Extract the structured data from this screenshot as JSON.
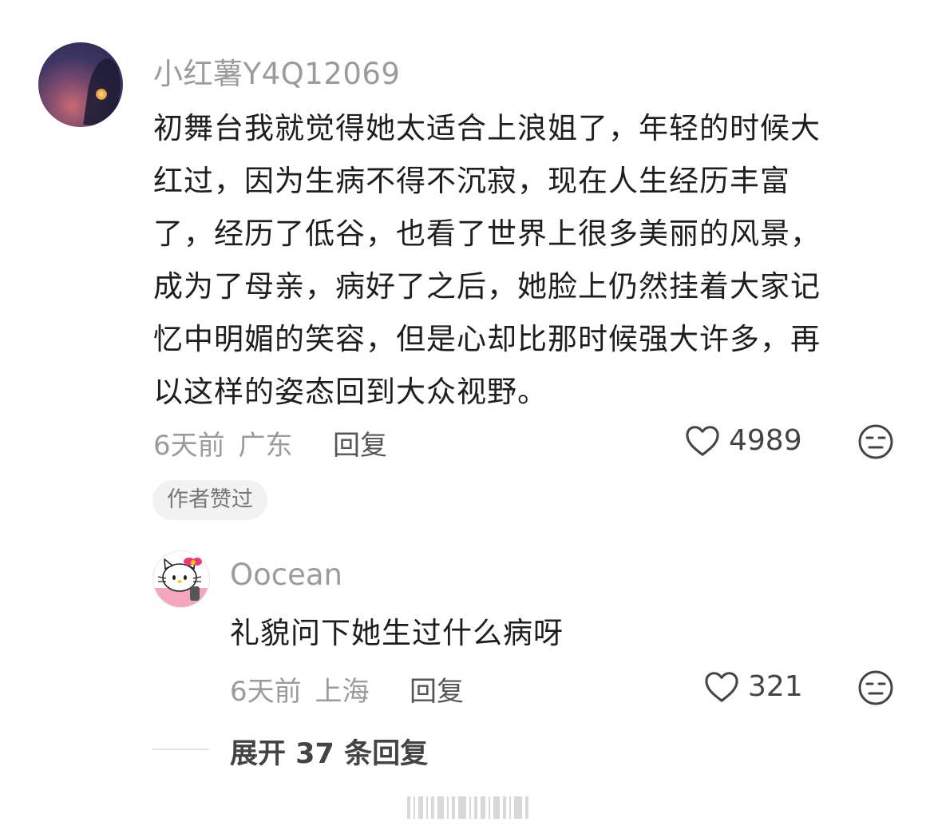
{
  "comment": {
    "username": "小红薯Y4Q12069",
    "lines": [
      "初舞台我就觉得她太适合上浪姐了，年轻的时候大",
      "红过，因为生病不得不沉寂，现在人生经历丰富",
      "了，经历了低谷，也看了世界上很多美丽的风景，",
      "成为了母亲，病好了之后，她脸上仍然挂着大家记",
      "忆中明媚的笑容，但是心却比那时候强大许多，再",
      "以这样的姿态回到大众视野。"
    ],
    "time": "6天前",
    "location": "广东",
    "reply_label": "回复",
    "likes": "4989",
    "badge": "作者赞过"
  },
  "reply": {
    "username": "Oocean",
    "text": "礼貌问下她生过什么病呀",
    "time": "6天前",
    "location": "上海",
    "reply_label": "回复",
    "likes": "321"
  },
  "expand_label": "展开 37 条回复"
}
